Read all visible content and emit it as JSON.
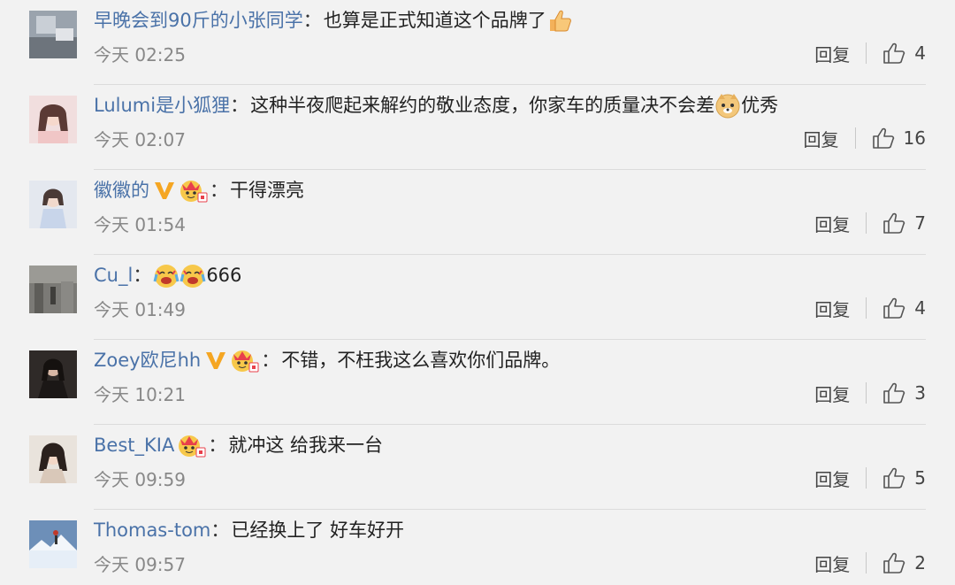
{
  "comments": [
    {
      "username": "早晚会到90斤的小张同学",
      "separator": "：",
      "text_before": "也算是正式知道这个品牌了",
      "text_after": "",
      "time": "今天 02:25",
      "reply": "回复",
      "likes": "4",
      "emoji": "thumbs-up"
    },
    {
      "username": "Lulumi是小狐狸",
      "separator": "：",
      "text_before": "这种半夜爬起来解约的敬业态度，你家车的质量决不会差",
      "text_after": "优秀",
      "time": "今天 02:07",
      "reply": "回复",
      "likes": "16",
      "emoji": "doge-face"
    },
    {
      "username": "徽徽的",
      "separator": "：",
      "text_before": "干得漂亮",
      "text_after": "",
      "time": "今天 01:54",
      "reply": "回复",
      "likes": "7",
      "badges": [
        "verified-v",
        "fan-badge"
      ]
    },
    {
      "username": "Cu_l",
      "separator": "：",
      "text_before": "",
      "text_after": "666",
      "time": "今天 01:49",
      "reply": "回复",
      "likes": "4",
      "emoji": "crying-laugh-x2"
    },
    {
      "username": "Zoey欧尼hh",
      "separator": "：",
      "text_before": "不错，不枉我这么喜欢你们品牌。",
      "text_after": "",
      "time": "今天 10:21",
      "reply": "回复",
      "likes": "3",
      "badges": [
        "verified-v",
        "fan-badge"
      ]
    },
    {
      "username": "Best_KIA",
      "separator": "：",
      "text_before": "就冲这 给我来一台",
      "text_after": "",
      "time": "今天 09:59",
      "reply": "回复",
      "likes": "5",
      "badges": [
        "fan-badge"
      ]
    },
    {
      "username": "Thomas-tom",
      "separator": "：",
      "text_before": "已经换上了 好车好开",
      "text_after": "",
      "time": "今天 09:57",
      "reply": "回复",
      "likes": "2"
    }
  ],
  "colors": {
    "username": "#4a72a8",
    "time": "#888888",
    "background": "#f2f2f2",
    "vbadge": "#f5a623"
  }
}
